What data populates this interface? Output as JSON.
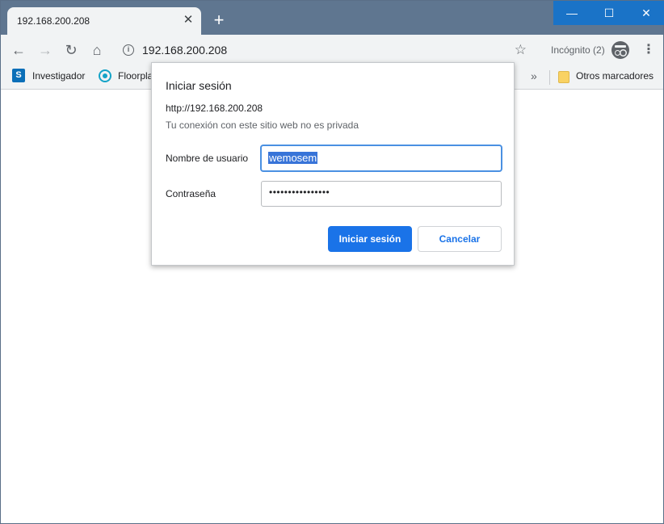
{
  "tab": {
    "title": "192.168.200.208"
  },
  "toolbar": {
    "url": "192.168.200.208",
    "incognito_label": "Incógnito (2)"
  },
  "bookmarks": {
    "items": [
      {
        "label": "Investigador",
        "icon": "sharepoint-icon"
      },
      {
        "label": "Floorpla",
        "icon": "floorplan-icon"
      }
    ],
    "other": "Otros marcadores"
  },
  "dialog": {
    "title": "Iniciar sesión",
    "url": "http://192.168.200.208",
    "note": "Tu conexión con este sitio web no es privada",
    "username_label": "Nombre de usuario",
    "username_value": "wemosem",
    "password_label": "Contraseña",
    "password_mask": "••••••••••••••••",
    "login_button": "Iniciar sesión",
    "cancel_button": "Cancelar"
  },
  "colors": {
    "titlebar": "#5f7690",
    "accent": "#1a73e8",
    "window_controls": "#1a73c7"
  }
}
